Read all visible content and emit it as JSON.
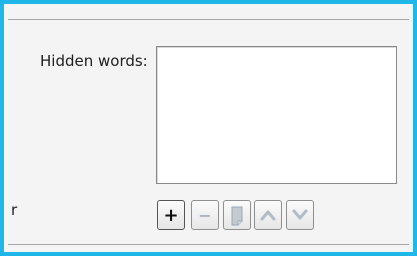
{
  "hidden_words": {
    "label": "Hidden words:",
    "items": []
  },
  "stray_text": "r",
  "toolbar": {
    "add_label": "+",
    "remove_label": "−",
    "edit_icon": "edit-icon",
    "up_icon": "chevron-up-icon",
    "down_icon": "chevron-down-icon"
  },
  "colors": {
    "accent_border": "#1fb6e8",
    "disabled_icon": "#b9c2cc"
  }
}
